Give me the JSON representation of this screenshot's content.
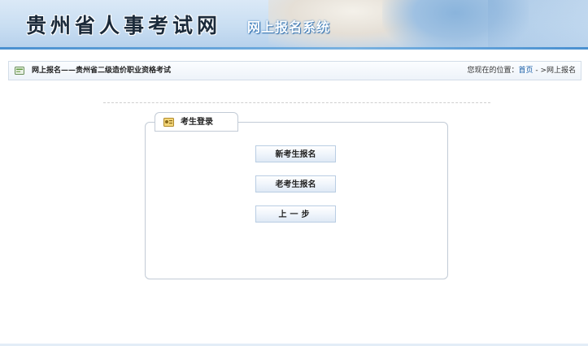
{
  "header": {
    "site_title": "贵州省人事考试网",
    "system_name": "网上报名系统"
  },
  "breadcrumb": {
    "current": "网上报名——贵州省二级造价职业资格考试",
    "location_prefix": "您现在的位置：",
    "home_link": "首页",
    "location_suffix": " - >网上报名"
  },
  "login_panel": {
    "tab_label": "考生登录",
    "buttons": {
      "new_candidate": "新考生报名",
      "returning_candidate": "老考生报名",
      "back": "上一步"
    }
  },
  "colors": {
    "accent": "#4a90d0",
    "link": "#1a5fa8",
    "panel_border": "#c2cbd6"
  }
}
